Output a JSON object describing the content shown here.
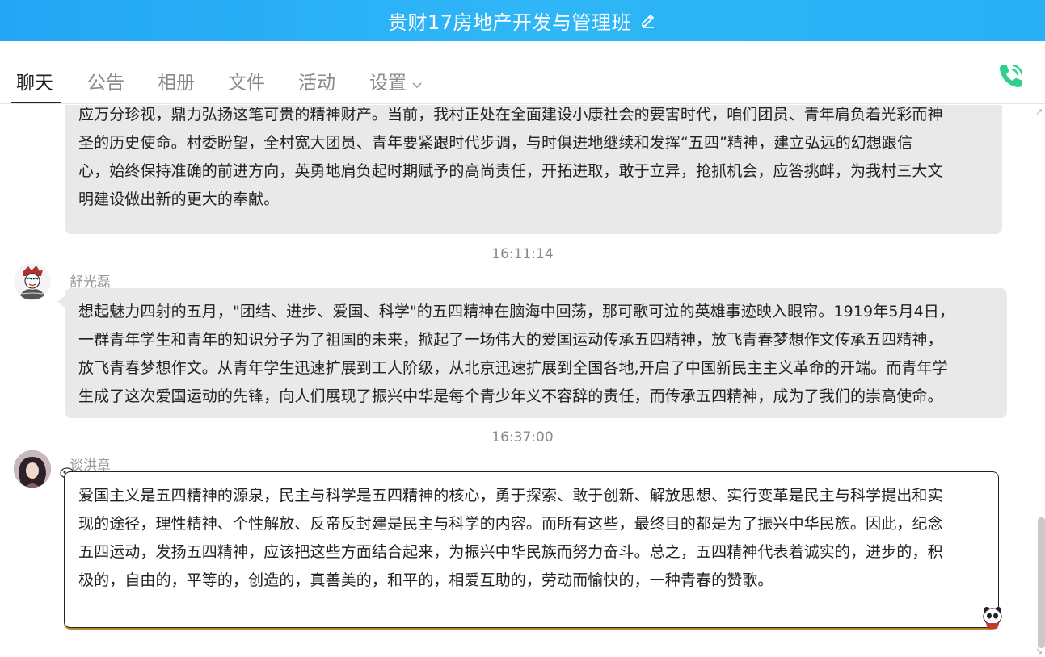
{
  "header": {
    "title": "贵财17房地产开发与管理班",
    "edit_icon": "pencil-icon",
    "background": "#23a7f5"
  },
  "tabs": [
    {
      "label": "聊天",
      "active": true
    },
    {
      "label": "公告",
      "active": false
    },
    {
      "label": "相册",
      "active": false
    },
    {
      "label": "文件",
      "active": false
    },
    {
      "label": "活动",
      "active": false
    },
    {
      "label": "设置",
      "active": false,
      "dropdown": true
    }
  ],
  "call_icon": "phone-icon",
  "call_color": "#2fd18a",
  "messages": [
    {
      "lines": [
        "应万分珍视，鼎力弘扬这笔可贵的精神财产。当前，我村正处在全面建设小康社会的要害时代，咱们团员、青年肩负着光彩而神",
        "圣的历史使命。村委盼望，全村宽大团员、青年要紧跟时代步调，与时俱进地继续和发挥“五四”精神，建立弘远的幻想跟信",
        "心，始终保持准确的前进方向，英勇地肩负起时期赋予的高尚责任，开拓进取，敢于立异，抢抓机会，应答挑衅，为我村三大文",
        "明建设做出新的更大的奉献。"
      ]
    },
    {
      "time": "16:11:14",
      "sender": "舒光磊",
      "lines": [
        "想起魅力四射的五月，\"团结、进步、爱国、科学\"的五四精神在脑海中回荡，那可歌可泣的英雄事迹映入眼帘。1919年5月4日，",
        "一群青年学生和青年的知识分子为了祖国的未来，掀起了一场伟大的爱国运动传承五四精神，放飞青春梦想作文传承五四精神，",
        "放飞青春梦想作文。从青年学生迅速扩展到工人阶级，从北京迅速扩展到全国各地,开启了中国新民主主义革命的开端。而青年学",
        "生成了这次爱国运动的先锋，向人们展现了振兴中华是每个青少年义不容辞的责任，而传承五四精神，成为了我们的崇高使命。"
      ]
    },
    {
      "time": "16:37:00",
      "sender": "谈洪章",
      "lines": [
        "爱国主义是五四精神的源泉，民主与科学是五四精神的核心，勇于探索、敢于创新、解放思想、实行变革是民主与科学提出和实",
        "现的途径，理性精神、个性解放、反帝反封建是民主与科学的内容。而所有这些，最终目的都是为了振兴中华民族。因此，纪念",
        "五四运动，发扬五四精神，应该把这些方面结合起来，为振兴中华民族而努力奋斗。总之，五四精神代表着诚实的，进步的，积",
        "极的，自由的，平等的，创造的，真善美的，和平的，相爱互助的，劳动而愉快的，一种青春的赞歌。"
      ]
    }
  ]
}
